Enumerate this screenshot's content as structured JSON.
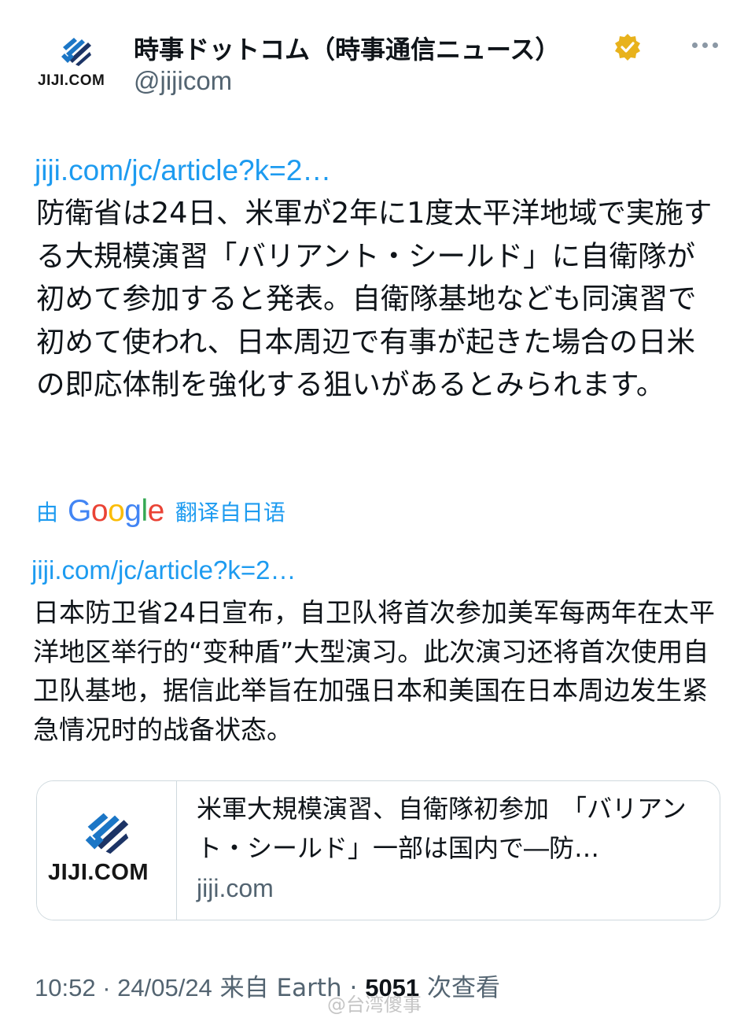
{
  "author": {
    "avatar_text": "JIJI.COM",
    "name": "時事ドットコム（時事通信ニュース）",
    "handle": "@jijicom",
    "verified": true,
    "verified_color": "#e8b21c"
  },
  "tweet": {
    "link_original": "jiji.com/jc/article?k=2…",
    "text_original": "防衛省は24日、米軍が2年に1度太平洋地域で実施する大規模演習「バリアント・シールド」に自衛隊が初めて参加すると発表。自衛隊基地なども同演習で初めて使われ、日本周辺で有事が起きた場合の日米の即応体制を強化する狙いがあるとみられます。",
    "translate_by": "由",
    "translate_brand": "Google",
    "translate_from": "翻译自日语",
    "link_translated": "jiji.com/jc/article?k=2…",
    "text_translated": "日本防卫省24日宣布，自卫队将首次参加美军每两年在太平洋地区举行的“变种盾”大型演习。此次演习还将首次使用自卫队基地，据信此举旨在加强日本和美国在日本周边发生紧急情况时的战备状态。"
  },
  "card": {
    "thumb_text": "JIJI.COM",
    "title": "米軍大規模演習、自衛隊初参加　「バリアント・シールド」一部は国内で―防…",
    "domain": "jiji.com"
  },
  "meta": {
    "time": "10:52 · 24/05/24",
    "source": " 来自 Earth · ",
    "views": "5051",
    "views_label": " 次查看"
  },
  "watermark": "@台湾傻事",
  "colors": {
    "link": "#1d9bf0",
    "text": "#0f1419",
    "secondary": "#536471",
    "border": "#cfd9de",
    "logo_blue": "#1b76c6",
    "logo_dark": "#1c3466"
  }
}
